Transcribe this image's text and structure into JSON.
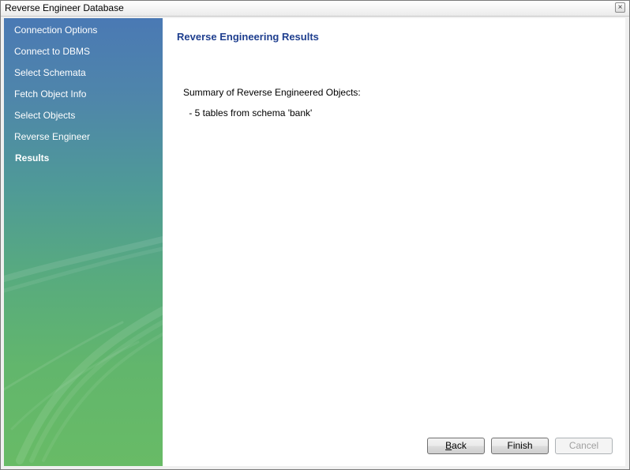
{
  "window": {
    "title": "Reverse Engineer Database",
    "close_label": "×"
  },
  "sidebar": {
    "items": [
      {
        "label": "Connection Options"
      },
      {
        "label": "Connect to DBMS"
      },
      {
        "label": "Select Schemata"
      },
      {
        "label": "Fetch Object Info"
      },
      {
        "label": "Select Objects"
      },
      {
        "label": "Reverse Engineer"
      },
      {
        "label": "Results",
        "active": true
      }
    ]
  },
  "main": {
    "title": "Reverse Engineering Results",
    "summary_heading": "Summary of Reverse Engineered Objects:",
    "summary_lines": [
      " - 5 tables from schema 'bank'"
    ]
  },
  "buttons": {
    "back_mnemonic": "B",
    "back_rest": "ack",
    "finish": "Finish",
    "cancel": "Cancel"
  },
  "colors": {
    "title_accent": "#1f3f8f",
    "sidebar_top": "#4a79b4",
    "sidebar_bottom": "#68bb66"
  }
}
